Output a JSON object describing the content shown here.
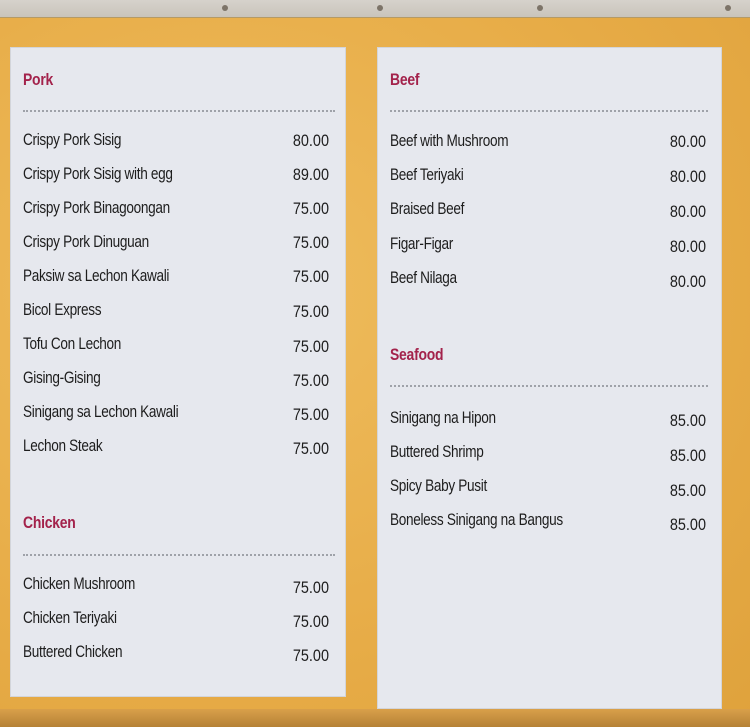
{
  "menu": {
    "pork": {
      "title": "Pork",
      "items": [
        {
          "name": "Crispy Pork Sisig",
          "price": "80.00"
        },
        {
          "name": "Crispy Pork Sisig with egg",
          "price": "89.00"
        },
        {
          "name": "Crispy Pork Binagoongan",
          "price": "75.00"
        },
        {
          "name": "Crispy Pork Dinuguan",
          "price": "75.00"
        },
        {
          "name": "Paksiw sa Lechon Kawali",
          "price": "75.00"
        },
        {
          "name": "Bicol Express",
          "price": "75.00"
        },
        {
          "name": "Tofu Con Lechon",
          "price": "75.00"
        },
        {
          "name": "Gising-Gising",
          "price": "75.00"
        },
        {
          "name": "Sinigang sa Lechon Kawali",
          "price": "75.00"
        },
        {
          "name": "Lechon Steak",
          "price": "75.00"
        }
      ]
    },
    "chicken": {
      "title": "Chicken",
      "items": [
        {
          "name": "Chicken Mushroom",
          "price": "75.00"
        },
        {
          "name": "Chicken Teriyaki",
          "price": "75.00"
        },
        {
          "name": "Buttered Chicken",
          "price": "75.00"
        }
      ]
    },
    "beef": {
      "title": "Beef",
      "items": [
        {
          "name": "Beef with Mushroom",
          "price": "80.00"
        },
        {
          "name": "Beef Teriyaki",
          "price": "80.00"
        },
        {
          "name": "Braised Beef",
          "price": "80.00"
        },
        {
          "name": "Figar-Figar",
          "price": "80.00"
        },
        {
          "name": "Beef Nilaga",
          "price": "80.00"
        }
      ]
    },
    "seafood": {
      "title": "Seafood",
      "items": [
        {
          "name": "Sinigang na Hipon",
          "price": "85.00"
        },
        {
          "name": "Buttered Shrimp",
          "price": "85.00"
        },
        {
          "name": "Spicy Baby Pusit",
          "price": "85.00"
        },
        {
          "name": "Boneless Sinigang na Bangus",
          "price": "85.00"
        }
      ]
    }
  }
}
